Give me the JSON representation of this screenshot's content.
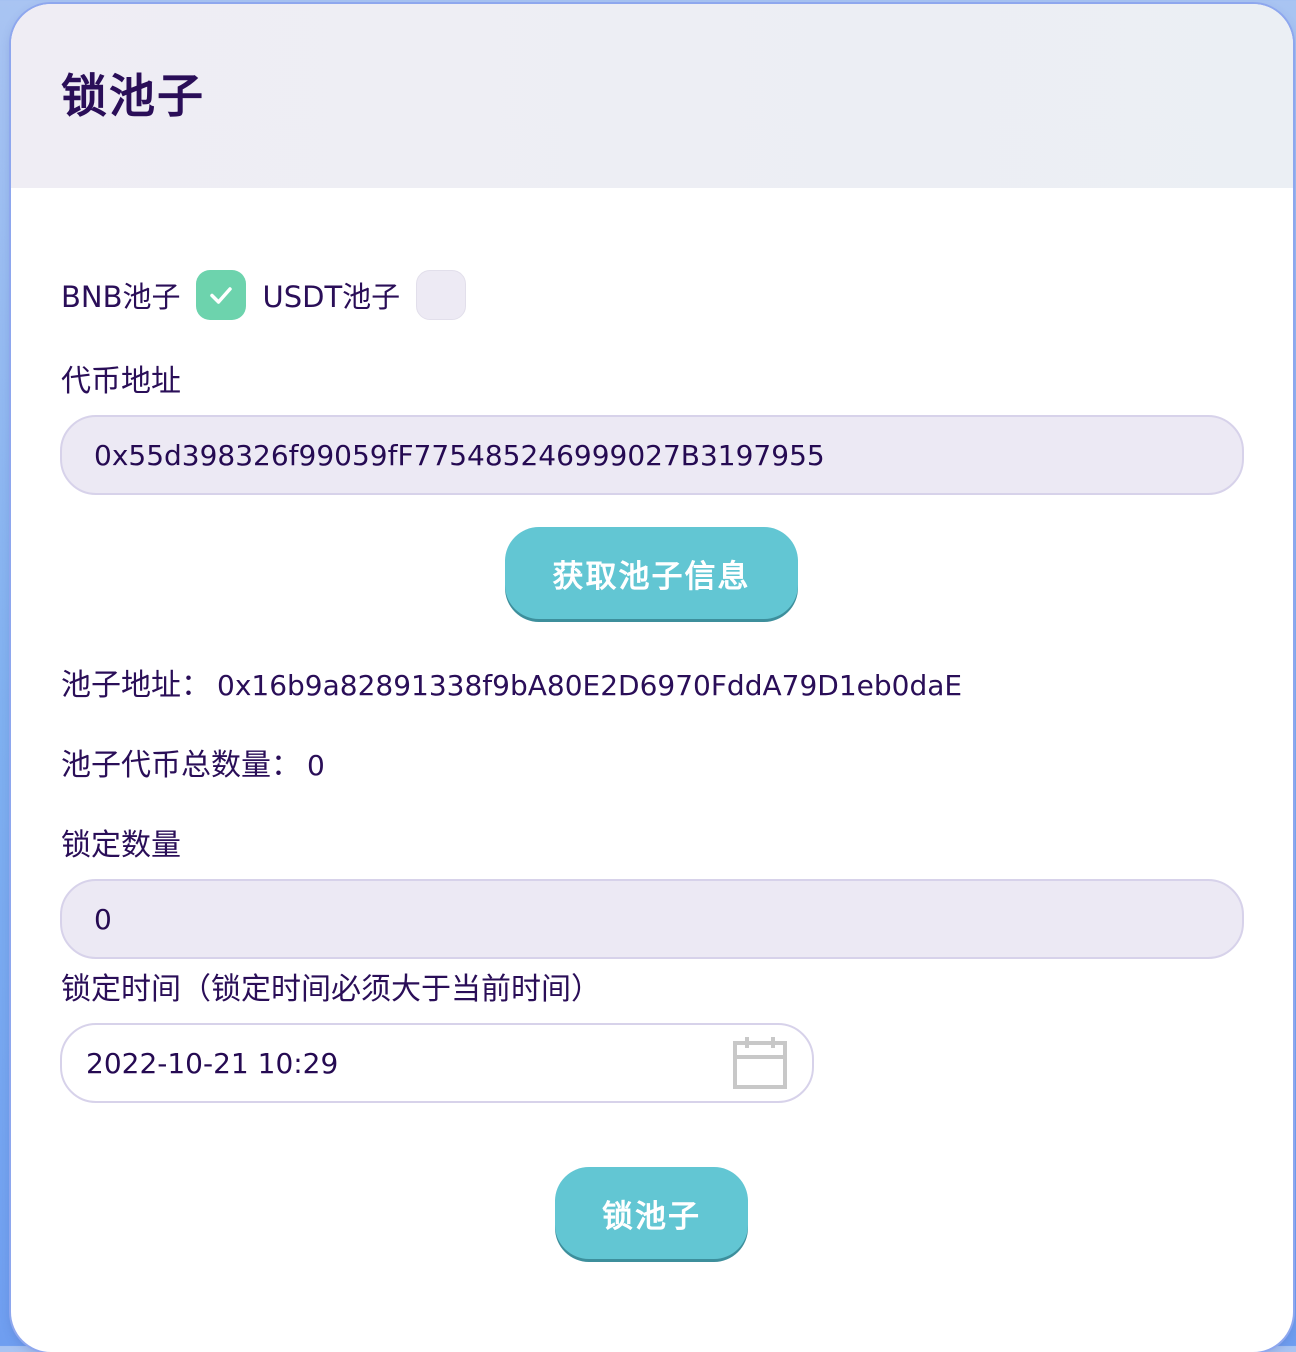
{
  "card": {
    "title": "锁池子"
  },
  "pools": {
    "bnb_label": "BNB池子",
    "bnb_checked": true,
    "usdt_label": "USDT池子",
    "usdt_checked": false
  },
  "token_address": {
    "label": "代币地址",
    "value": "0x55d398326f99059fF775485246999027B3197955"
  },
  "fetch_button": {
    "label": "获取池子信息"
  },
  "pool_info": {
    "address_label": "池子地址：",
    "address_value": "0x16b9a82891338f9bA80E2D6970FddA79D1eb0daE",
    "total_label": "池子代币总数量：",
    "total_value": "0"
  },
  "lock_amount": {
    "label": "锁定数量",
    "value": "0"
  },
  "lock_time": {
    "label": "锁定时间（锁定时间必须大于当前时间）",
    "value": "2022-10-21 10:29",
    "icon": "calendar-icon"
  },
  "lock_button": {
    "label": "锁池子"
  },
  "colors": {
    "accent": "#62c6d3",
    "checkbox_checked": "#6dd3ad",
    "text": "#2a0e58",
    "input_bg": "#ece9f4"
  }
}
